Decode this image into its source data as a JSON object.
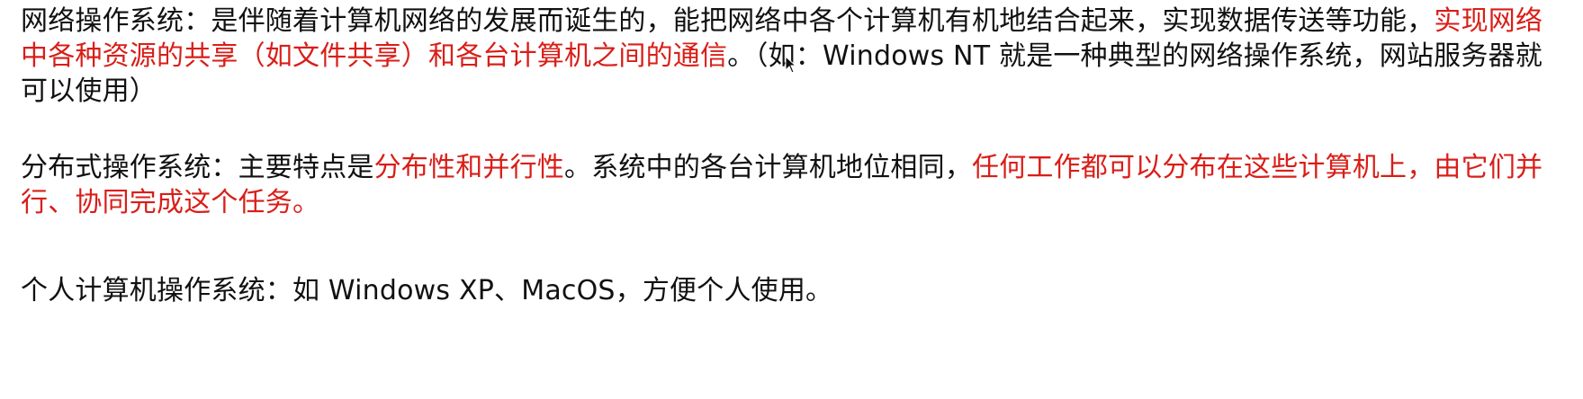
{
  "paragraphs": [
    {
      "id": "network-os",
      "segments": [
        {
          "text": "网络操作系统：是伴随着计算机网络的发展而诞生的，能把网络中各个计算机有机地结合起来，实现数据传送等功能，",
          "color": "black"
        },
        {
          "text": "实现网络中各种资源的共享（如文件共享）和各台计算机之间的通信",
          "color": "red"
        },
        {
          "text": "。（如：Windows NT 就是一种典型的网络操作系统，网站服务器就可以使用）",
          "color": "black"
        }
      ]
    },
    {
      "id": "distributed-os",
      "segments": [
        {
          "text": "分布式操作系统：主要特点是",
          "color": "black"
        },
        {
          "text": "分布性和并行性",
          "color": "red"
        },
        {
          "text": "。系统中的各台计算机地位相同，",
          "color": "black"
        },
        {
          "text": "任何工作都可以分布在这些计算机上，由它们并行、协同完成这个任务。",
          "color": "red"
        }
      ]
    },
    {
      "id": "personal-os",
      "segments": [
        {
          "text": "个人计算机操作系统：如 Windows XP、MacOS，方便个人使用。",
          "color": "black"
        }
      ]
    }
  ],
  "colors": {
    "text": "#111111",
    "highlight": "#d91e18",
    "background": "#ffffff"
  },
  "cursor_icon": "mouse-pointer-icon"
}
